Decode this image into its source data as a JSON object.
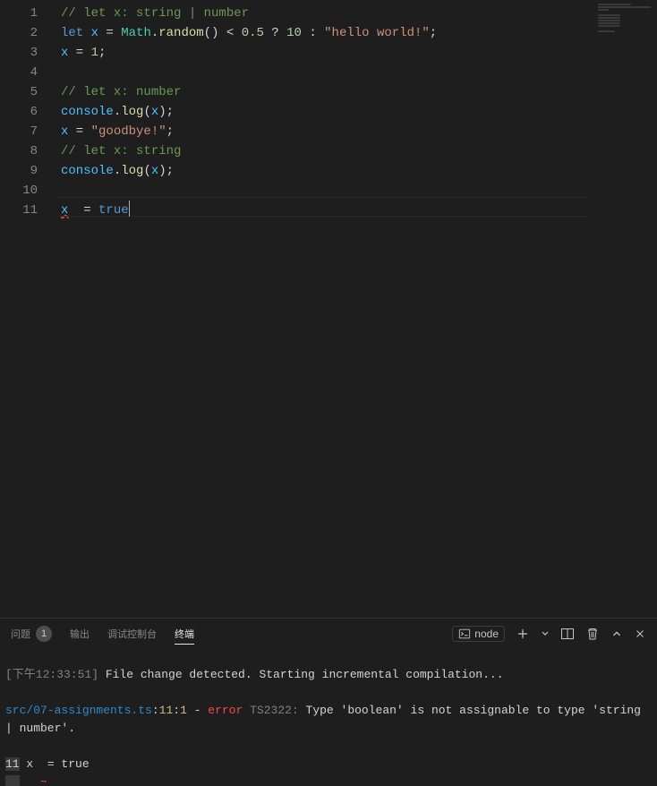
{
  "editor": {
    "lines": [
      {
        "n": 1,
        "tokens": [
          {
            "t": "// let x: string | number",
            "c": "tok-comment"
          }
        ]
      },
      {
        "n": 2,
        "tokens": [
          {
            "t": "let ",
            "c": "tok-keyword"
          },
          {
            "t": "x",
            "c": "tok-var"
          },
          {
            "t": " = ",
            "c": "tok-op"
          },
          {
            "t": "Math",
            "c": "tok-object"
          },
          {
            "t": ".",
            "c": "tok-punct"
          },
          {
            "t": "random",
            "c": "tok-func"
          },
          {
            "t": "() < ",
            "c": "tok-punct"
          },
          {
            "t": "0.5",
            "c": "tok-number"
          },
          {
            "t": " ? ",
            "c": "tok-op"
          },
          {
            "t": "10",
            "c": "tok-number"
          },
          {
            "t": " : ",
            "c": "tok-op"
          },
          {
            "t": "\"hello world!\"",
            "c": "tok-string"
          },
          {
            "t": ";",
            "c": "tok-punct"
          }
        ]
      },
      {
        "n": 3,
        "tokens": [
          {
            "t": "x",
            "c": "tok-var"
          },
          {
            "t": " = ",
            "c": "tok-op"
          },
          {
            "t": "1",
            "c": "tok-number"
          },
          {
            "t": ";",
            "c": "tok-punct"
          }
        ]
      },
      {
        "n": 4,
        "tokens": []
      },
      {
        "n": 5,
        "tokens": [
          {
            "t": "// let x: number",
            "c": "tok-comment"
          }
        ]
      },
      {
        "n": 6,
        "tokens": [
          {
            "t": "console",
            "c": "tok-var"
          },
          {
            "t": ".",
            "c": "tok-punct"
          },
          {
            "t": "log",
            "c": "tok-func"
          },
          {
            "t": "(",
            "c": "tok-punct"
          },
          {
            "t": "x",
            "c": "tok-var"
          },
          {
            "t": ");",
            "c": "tok-punct"
          }
        ]
      },
      {
        "n": 7,
        "tokens": [
          {
            "t": "x",
            "c": "tok-var"
          },
          {
            "t": " = ",
            "c": "tok-op"
          },
          {
            "t": "\"goodbye!\"",
            "c": "tok-string"
          },
          {
            "t": ";",
            "c": "tok-punct"
          }
        ]
      },
      {
        "n": 8,
        "tokens": [
          {
            "t": "// let x: string",
            "c": "tok-comment"
          }
        ]
      },
      {
        "n": 9,
        "tokens": [
          {
            "t": "console",
            "c": "tok-var"
          },
          {
            "t": ".",
            "c": "tok-punct"
          },
          {
            "t": "log",
            "c": "tok-func"
          },
          {
            "t": "(",
            "c": "tok-punct"
          },
          {
            "t": "x",
            "c": "tok-var"
          },
          {
            "t": ");",
            "c": "tok-punct"
          }
        ]
      },
      {
        "n": 10,
        "tokens": []
      },
      {
        "n": 11,
        "active": true,
        "tokens": [
          {
            "t": "x",
            "c": "tok-var err-underline"
          },
          {
            "t": "  = ",
            "c": "tok-op"
          },
          {
            "t": "true",
            "c": "tok-keyword"
          }
        ],
        "cursor": true
      }
    ]
  },
  "panel": {
    "tabs": {
      "problems": {
        "label": "问题",
        "count": "1"
      },
      "output": {
        "label": "输出"
      },
      "debug": {
        "label": "调试控制台"
      },
      "terminal": {
        "label": "终端"
      }
    },
    "selector": "node",
    "terminal": {
      "line1": {
        "time": "[下午12:33:51]",
        "msg": " File change detected. Starting incremental compilation..."
      },
      "line2": {
        "file": "src/07-assignments.ts",
        "colon1": ":",
        "pos1": "11",
        "colon2": ":",
        "pos2": "1",
        "dash": " - ",
        "err": "error",
        "space": " ",
        "code": "TS2322:",
        "msg": " Type 'boolean' is not assignable to type 'string | number'."
      },
      "line3": {
        "ln": "11",
        "code": " x  = true"
      },
      "line4": {
        "pad": "   ",
        "squiggle": "~"
      }
    }
  }
}
